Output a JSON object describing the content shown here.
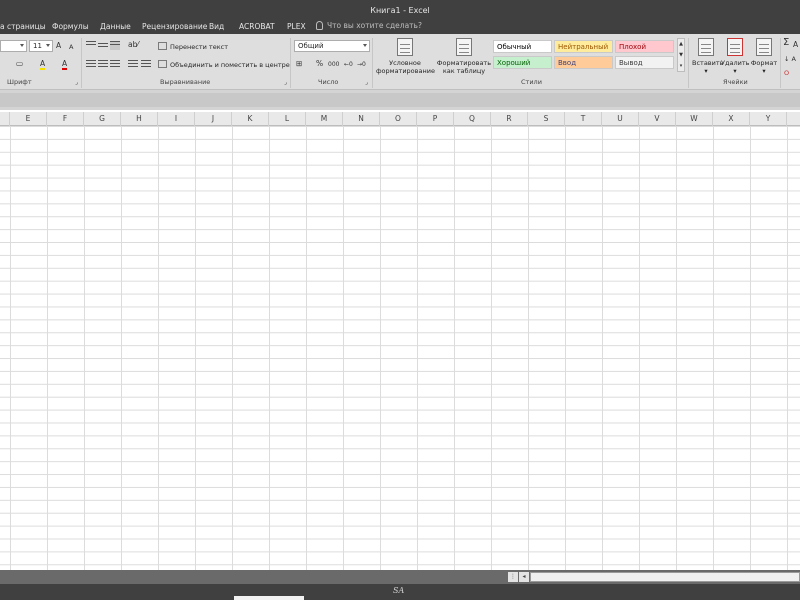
{
  "window": {
    "title": "Книга1 - Excel"
  },
  "menu": {
    "tabs": [
      "а страницы",
      "Формулы",
      "Данные",
      "Рецензирование",
      "Вид",
      "ACROBAT",
      "PLEX"
    ],
    "tell_me": "Что вы хотите сделать?"
  },
  "ribbon": {
    "font": {
      "size_value": "11",
      "grow_label": "A",
      "shrink_label": "A",
      "group_label": "Шрифт",
      "fill_label": "A",
      "color_label": "A"
    },
    "alignment": {
      "wrap_label": "Перенести текст",
      "merge_label": "Объединить и поместить в центре",
      "group_label": "Выравнивание"
    },
    "number": {
      "format_value": "Общий",
      "percent_label": "%",
      "thousands_label": "000",
      "group_label": "Число"
    },
    "styles": {
      "conditional_label_1": "Условное",
      "conditional_label_2": "форматирование",
      "table_label_1": "Форматировать",
      "table_label_2": "как таблицу",
      "cells": [
        {
          "label": "Обычный",
          "bg": "#ffffff",
          "fg": "#000000"
        },
        {
          "label": "Нейтральный",
          "bg": "#ffeb9c",
          "fg": "#9c5700"
        },
        {
          "label": "Плохой",
          "bg": "#ffc7ce",
          "fg": "#9c0006"
        },
        {
          "label": "Хороший",
          "bg": "#c6efce",
          "fg": "#006100"
        },
        {
          "label": "Ввод",
          "bg": "#ffcc99",
          "fg": "#3f3f76"
        },
        {
          "label": "Вывод",
          "bg": "#f2f2f2",
          "fg": "#3f3f3f"
        }
      ],
      "group_label": "Стили"
    },
    "cells": {
      "insert_label": "Вставить",
      "delete_label": "Удалить",
      "format_label": "Формат",
      "group_label": "Ячейки"
    },
    "editing": {
      "sum_label": "A",
      "icon_2": "↓ A",
      "icon_3": "О"
    }
  },
  "columns": [
    "E",
    "F",
    "G",
    "H",
    "I",
    "J",
    "K",
    "L",
    "M",
    "N",
    "O",
    "P",
    "Q",
    "R",
    "S",
    "T",
    "U",
    "V",
    "W",
    "X",
    "Y"
  ],
  "status": {
    "watermark": "SA"
  },
  "colors": {
    "title_bg": "#404040",
    "ribbon_bg": "#dedede",
    "grid_line": "#dcdcdc"
  }
}
